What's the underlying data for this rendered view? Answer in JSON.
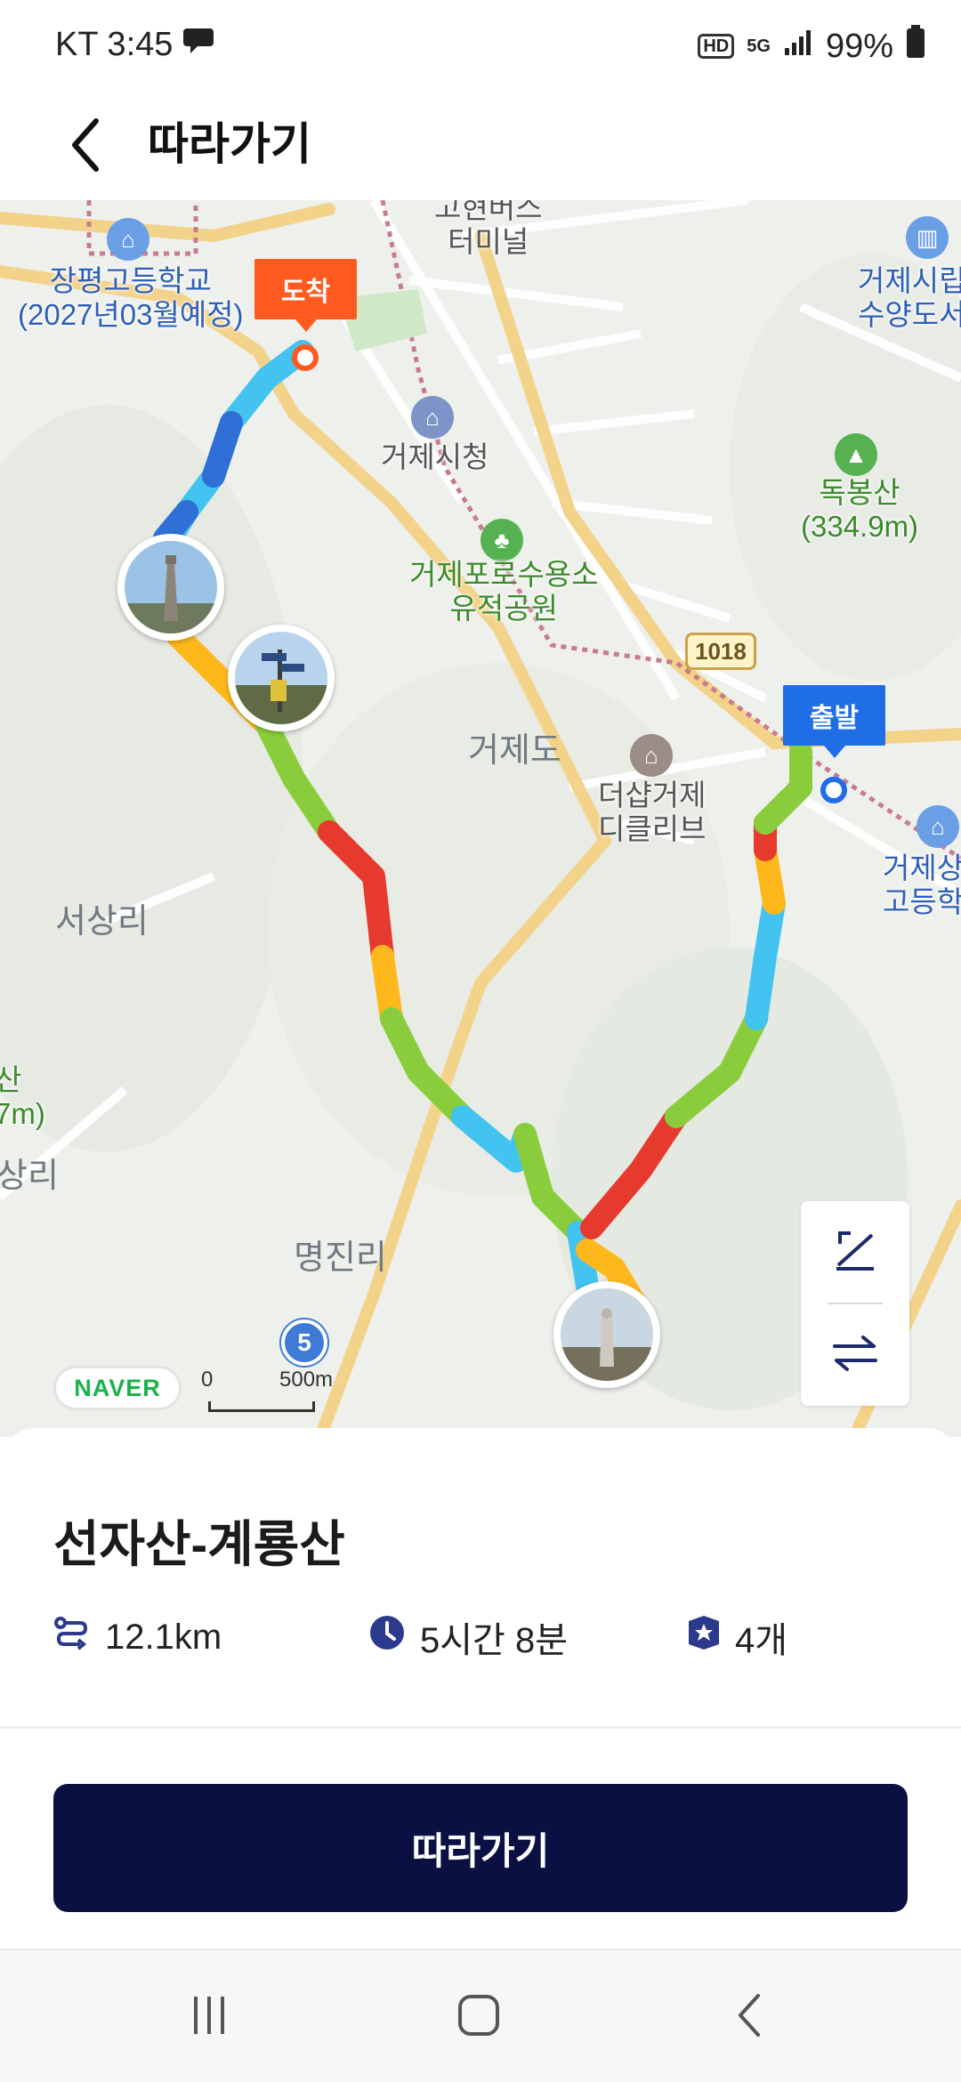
{
  "status_bar": {
    "carrier_time": "KT 3:45",
    "network_chip": "HD",
    "network_type": "5G",
    "battery": "99%"
  },
  "header": {
    "title": "따라가기",
    "back_icon": "chevron-left-icon"
  },
  "map": {
    "labels": {
      "bus_terminal": "고현버스\n터미널",
      "school_left": "장평고등학교\n(2027년03월예정)",
      "city_hall": "거제시청",
      "library_right": "거제시립\n수양도서",
      "mountain": "독봉산\n(334.9m)",
      "pow_camp": "거제포로수용소\n유적공원",
      "island": "거제도",
      "mall": "더샵거제\n디클리브",
      "school_right": "거제상\n고등학",
      "village1": "서상리",
      "village2": "명진리",
      "edge_mountain": "산\n7m)",
      "edge_village": "상리"
    },
    "road_number": "1018",
    "route_number": "5",
    "marker_arrive": "도착",
    "marker_start": "출발",
    "naver_logo": "NAVER",
    "scale_zero": "0",
    "scale_distance": "500m",
    "controls": [
      "elevation-icon",
      "swap-direction-icon"
    ],
    "photo_count": 4,
    "route_segment_colors": [
      "#2f6fd6",
      "#43c3f0",
      "#8acd3c",
      "#ffb81c",
      "#e73a2e"
    ]
  },
  "course": {
    "title": "선자산-계룡산",
    "distance": "12.1km",
    "duration": "5시간 8분",
    "waypoints": "4개",
    "distance_icon": "route-icon",
    "duration_icon": "clock-icon",
    "waypoints_icon": "star-badge-icon"
  },
  "follow_button": "따라가기",
  "colors": {
    "primary_button": "#0a1142",
    "arrive": "#ff5a1f",
    "start": "#1f6ee6",
    "icon_accent": "#2b3a8c"
  },
  "nav_bar": [
    "recents-icon",
    "home-icon",
    "back-icon"
  ]
}
